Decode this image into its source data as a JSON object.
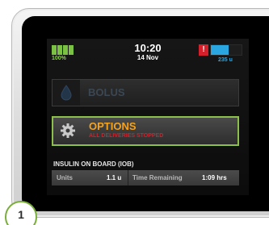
{
  "status_bar": {
    "battery_percent": "100%",
    "battery_cells": 4,
    "time": "10:20",
    "date": "14 Nov",
    "alert_symbol": "!",
    "reservoir_units": "235 u",
    "reservoir_level": 0.58,
    "battery_color": "#7bc143",
    "reservoir_color": "#2aa6e0",
    "alert_color": "#d4202a"
  },
  "menu": {
    "bolus": {
      "label": "BOLUS",
      "icon": "insulin-drop-icon",
      "enabled": false
    },
    "options": {
      "label": "OPTIONS",
      "sublabel": "ALL DELIVERIES STOPPED",
      "icon": "gear-icon",
      "selected": true,
      "highlight_color": "#8cc04a"
    }
  },
  "iob": {
    "title": "INSULIN ON BOARD (IOB)",
    "units_label": "Units",
    "units_value": "1.1 u",
    "time_label": "Time Remaining",
    "time_value": "1:09 hrs"
  },
  "step": {
    "number": "1"
  }
}
